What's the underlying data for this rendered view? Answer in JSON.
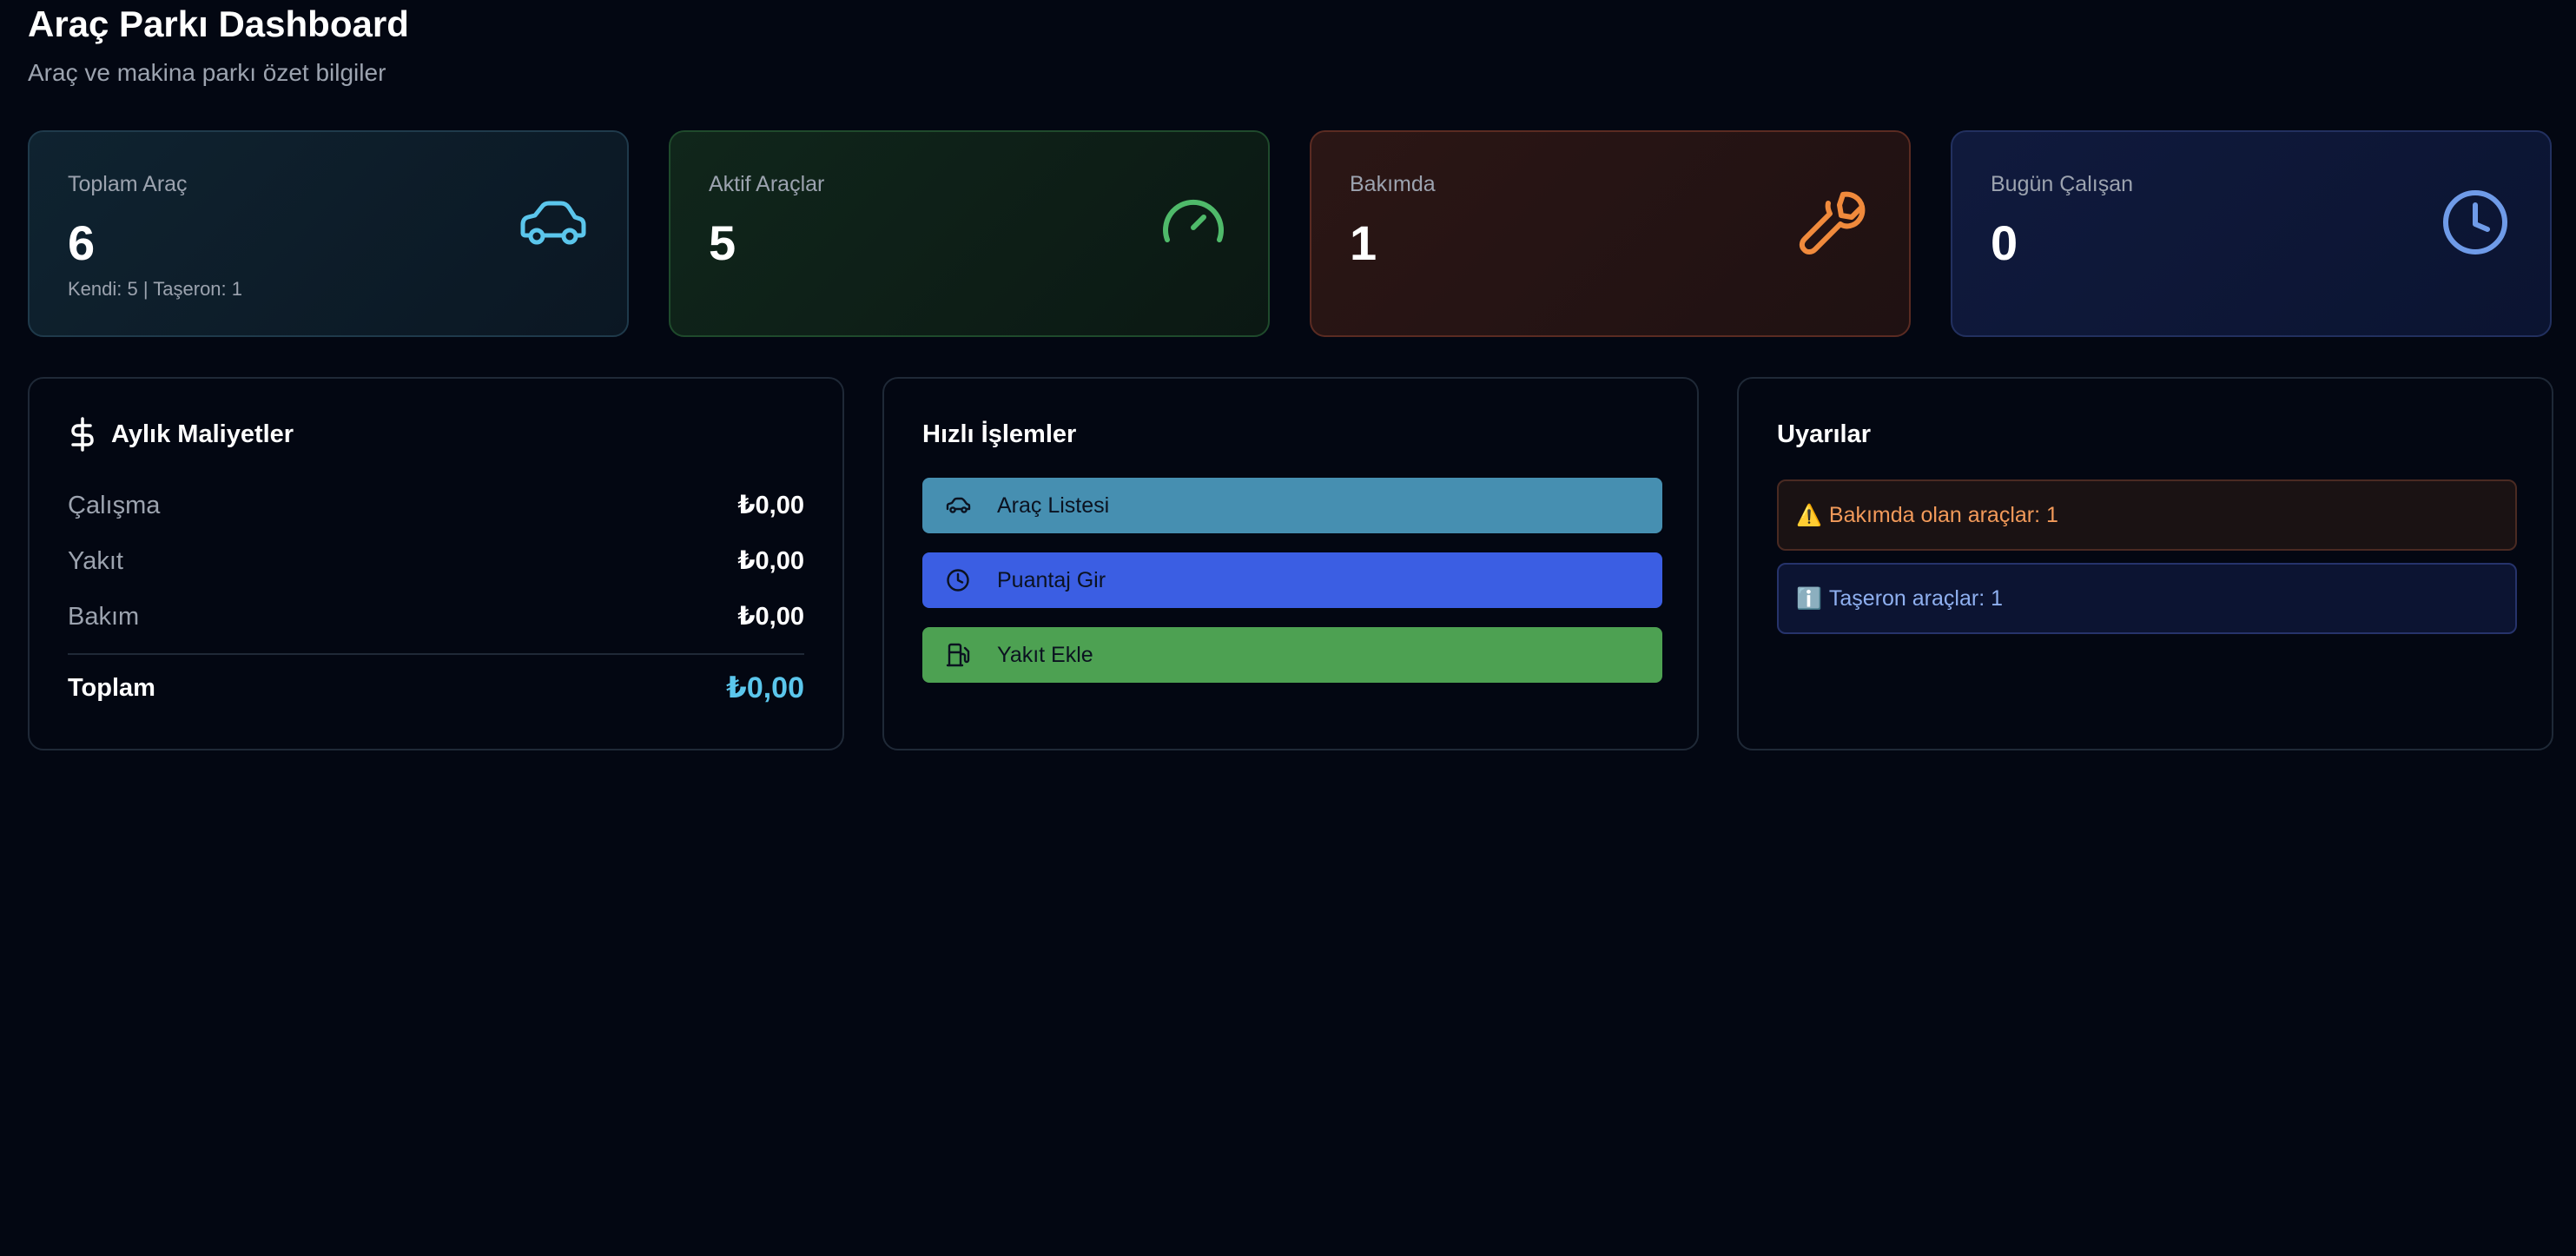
{
  "header": {
    "title": "Araç Parkı Dashboard",
    "subtitle": "Araç ve makina parkı özet bilgiler"
  },
  "stats": [
    {
      "label": "Toplam Araç",
      "value": "6",
      "sub": "Kendi: 5 | Taşeron: 1",
      "icon": "car-icon",
      "color": "#5bc6ec"
    },
    {
      "label": "Aktif Araçlar",
      "value": "5",
      "icon": "gauge-icon",
      "color": "#4fba6a"
    },
    {
      "label": "Bakımda",
      "value": "1",
      "icon": "wrench-icon",
      "color": "#f08a3c"
    },
    {
      "label": "Bugün Çalışan",
      "value": "0",
      "icon": "clock-icon",
      "color": "#6f9be8"
    }
  ],
  "costs": {
    "title": "Aylık Maliyetler",
    "icon": "dollar-icon",
    "rows": [
      {
        "label": "Çalışma",
        "value": "₺0,00"
      },
      {
        "label": "Yakıt",
        "value": "₺0,00"
      },
      {
        "label": "Bakım",
        "value": "₺0,00"
      }
    ],
    "total_label": "Toplam",
    "total_value": "₺0,00"
  },
  "quick": {
    "title": "Hızlı İşlemler",
    "buttons": [
      {
        "label": "Araç Listesi",
        "icon": "car-icon",
        "color": "#468fb1"
      },
      {
        "label": "Puantaj Gir",
        "icon": "clock-icon",
        "color": "#3b5ee3"
      },
      {
        "label": "Yakıt Ekle",
        "icon": "fuel-icon",
        "color": "#4da152"
      }
    ]
  },
  "alerts": {
    "title": "Uyarılar",
    "items": [
      {
        "text": "Bakımda olan araçlar: 1",
        "icon": "warning-icon"
      },
      {
        "text": "Taşeron araçlar: 1",
        "icon": "info-icon"
      }
    ]
  }
}
